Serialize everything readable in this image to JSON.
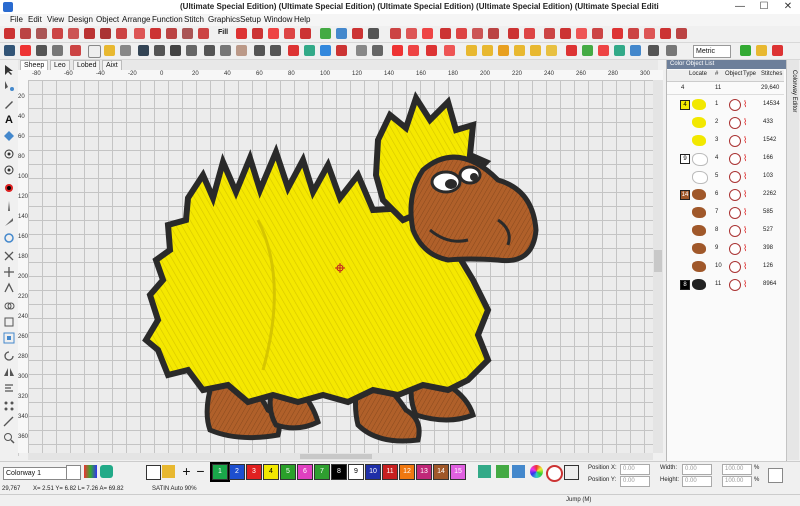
{
  "window": {
    "title": "(Ultimate Special Edition) (Ultimate Special Edition) (Ultimate Special Edition) (Ultimate Special Edition) (Ultimate Special Editi",
    "minimize": "—",
    "maximize": "☐",
    "close": "✕"
  },
  "menu": [
    "File",
    "Edit",
    "View",
    "Design",
    "Object",
    "Arrange",
    "Function",
    "Stitch",
    "Graphics",
    "Setup",
    "Window",
    "Help"
  ],
  "toolbar": {
    "fill_label": "Fill",
    "units": "Metric"
  },
  "tabs": [
    "Sheep",
    "Leo",
    "Lobed",
    "Aixt"
  ],
  "ruler": {
    "h_ticks": [
      "-80",
      "-60",
      "-40",
      "-20",
      "0",
      "20",
      "40",
      "60",
      "80",
      "100",
      "120",
      "140",
      "160",
      "180",
      "200",
      "220",
      "240",
      "260",
      "280",
      "300",
      "320"
    ],
    "v_ticks": [
      "20",
      "40",
      "60",
      "80",
      "100",
      "120",
      "140",
      "160",
      "180",
      "200",
      "220",
      "240",
      "260",
      "280",
      "300",
      "320",
      "340",
      "360"
    ]
  },
  "panel": {
    "title": "Color Object List",
    "col_locate": "Locate",
    "col_num": "#",
    "col_object": "Object",
    "col_type": "Type",
    "col_stitches": "Stitches",
    "summary": {
      "colors": "4",
      "objects": "11",
      "stitches": "29,640"
    },
    "rows": [
      {
        "swatch": "4",
        "swatch_color": "#f2e800",
        "num": "1",
        "stitches": "14534",
        "thumb_color": "#f2e800"
      },
      {
        "swatch": "",
        "swatch_color": "",
        "num": "2",
        "stitches": "433",
        "thumb_color": "#f2e800"
      },
      {
        "swatch": "",
        "swatch_color": "",
        "num": "3",
        "stitches": "1542",
        "thumb_color": "#f2e800"
      },
      {
        "swatch": "9",
        "swatch_color": "#ffffff",
        "num": "4",
        "stitches": "166",
        "thumb_color": "#ffffff"
      },
      {
        "swatch": "",
        "swatch_color": "",
        "num": "5",
        "stitches": "103",
        "thumb_color": "#ffffff"
      },
      {
        "swatch": "14",
        "swatch_color": "#a0582a",
        "num": "6",
        "stitches": "2262",
        "thumb_color": "#a0582a"
      },
      {
        "swatch": "",
        "swatch_color": "",
        "num": "7",
        "stitches": "585",
        "thumb_color": "#a0582a"
      },
      {
        "swatch": "",
        "swatch_color": "",
        "num": "8",
        "stitches": "527",
        "thumb_color": "#a0582a"
      },
      {
        "swatch": "",
        "swatch_color": "",
        "num": "9",
        "stitches": "398",
        "thumb_color": "#a0582a"
      },
      {
        "swatch": "",
        "swatch_color": "",
        "num": "10",
        "stitches": "126",
        "thumb_color": "#a0582a"
      },
      {
        "swatch": "8",
        "swatch_color": "#000000",
        "num": "11",
        "stitches": "8964",
        "thumb_color": "#222222"
      }
    ]
  },
  "side_tab": "Colorway Editor",
  "colorway": {
    "selected": "Colorway 1"
  },
  "palette": [
    {
      "label": "1",
      "color": "#1aa84a"
    },
    {
      "label": "2",
      "color": "#1d4fcf"
    },
    {
      "label": "3",
      "color": "#e02020"
    },
    {
      "label": "4",
      "color": "#f2e800"
    },
    {
      "label": "5",
      "color": "#2aa02a"
    },
    {
      "label": "6",
      "color": "#e040c0"
    },
    {
      "label": "7",
      "color": "#2f9f30"
    },
    {
      "label": "8",
      "color": "#000000"
    },
    {
      "label": "9",
      "color": "#ffffff"
    },
    {
      "label": "10",
      "color": "#1f2fa8"
    },
    {
      "label": "11",
      "color": "#c82020"
    },
    {
      "label": "12",
      "color": "#f07810"
    },
    {
      "label": "13",
      "color": "#c02878"
    },
    {
      "label": "14",
      "color": "#a0582a"
    },
    {
      "label": "15",
      "color": "#e060e0"
    }
  ],
  "position": {
    "x_label": "Position X:",
    "y_label": "Position Y:",
    "x_val": "0.00",
    "y_val": "0.00",
    "w_label": "Width:",
    "h_label": "Height:",
    "w_val": "0.00",
    "h_val": "0.00",
    "w_pct": "100.00",
    "h_pct": "100.00",
    "unit": "%"
  },
  "status": {
    "stitch_count": "29,767",
    "coords": "X= 2.51 Y= 6.82 L= 7.26 A= 69.82",
    "stitch_type": "SATIN Auto 90%",
    "mode": "Jump (M)"
  }
}
